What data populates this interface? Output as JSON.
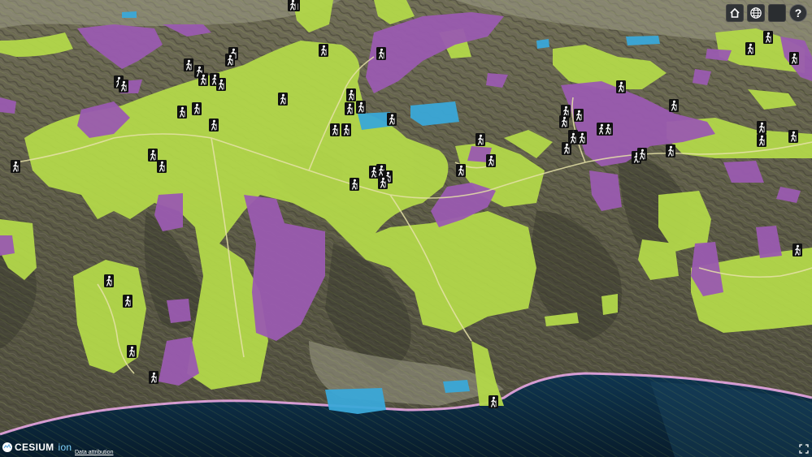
{
  "map": {
    "logo_text": "CESIUM",
    "logo_suffix": "ion",
    "attribution_link": "Data attribution",
    "help_label": "?"
  },
  "toolbar": {
    "buttons": [
      {
        "name": "home-button",
        "icon": "home-icon"
      },
      {
        "name": "globe-button",
        "icon": "globe-icon"
      },
      {
        "name": "layers-button",
        "icon": "blank-icon"
      },
      {
        "name": "help-button",
        "icon": "help-icon"
      }
    ]
  },
  "colors": {
    "open_space": "#b3d84a",
    "protected_land": "#9a5bb0",
    "water_body": "#3aa8d8",
    "ocean": "#0c2a40",
    "coast_line": "#e9a6e4",
    "trail": "#e6e2a8",
    "terrain": "#5e5c48"
  },
  "markers": {
    "icon": "hiker-icon",
    "count": 70
  }
}
